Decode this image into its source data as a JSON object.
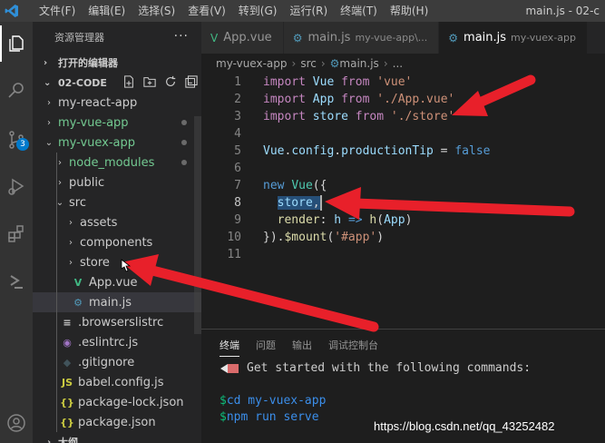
{
  "titlebar": {
    "menu": [
      "文件(F)",
      "编辑(E)",
      "选择(S)",
      "查看(V)",
      "转到(G)",
      "运行(R)",
      "终端(T)",
      "帮助(H)"
    ],
    "title": "main.js - 02-c"
  },
  "activitybar": {
    "icons": [
      "explorer-icon",
      "search-icon",
      "source-control-icon",
      "run-debug-icon",
      "extensions-icon",
      "remote-icon",
      "account-icon"
    ],
    "scm_badge": "3"
  },
  "sidebar": {
    "header": "资源管理器",
    "more": "···",
    "open_editors": "打开的编辑器",
    "workspace": "02-CODE",
    "tree": [
      {
        "label": "my-react-app",
        "chev": "›",
        "depth": 1,
        "color": "#cccccc",
        "dot": false
      },
      {
        "label": "my-vue-app",
        "chev": "›",
        "depth": 1,
        "color": "#73c991",
        "dot": true
      },
      {
        "label": "my-vuex-app",
        "chev": "⌄",
        "depth": 1,
        "color": "#73c991",
        "dot": true
      },
      {
        "label": "node_modules",
        "chev": "›",
        "depth": 2,
        "color": "#73c991",
        "dot": true
      },
      {
        "label": "public",
        "chev": "›",
        "depth": 2,
        "color": "#cccccc",
        "dot": false
      },
      {
        "label": "src",
        "chev": "⌄",
        "depth": 2,
        "color": "#cccccc",
        "dot": false
      },
      {
        "label": "assets",
        "chev": "›",
        "depth": 3,
        "color": "#cccccc",
        "dot": false
      },
      {
        "label": "components",
        "chev": "›",
        "depth": 3,
        "color": "#cccccc",
        "dot": false
      },
      {
        "label": "store",
        "chev": "›",
        "depth": 3,
        "color": "#cccccc",
        "dot": false
      },
      {
        "label": "App.vue",
        "chev": "",
        "depth": 3,
        "color": "#cccccc",
        "icon": "V",
        "iconColor": "#41b883",
        "dot": false
      },
      {
        "label": "main.js",
        "chev": "",
        "depth": 3,
        "color": "#cccccc",
        "icon": "⚙",
        "iconColor": "#519aba",
        "dot": false,
        "selected": true
      },
      {
        "label": ".browserslistrc",
        "chev": "",
        "depth": 2,
        "color": "#cccccc",
        "icon": "≡",
        "iconColor": "#cccccc",
        "dot": false
      },
      {
        "label": ".eslintrc.js",
        "chev": "",
        "depth": 2,
        "color": "#cccccc",
        "icon": "◉",
        "iconColor": "#a074c4",
        "dot": false
      },
      {
        "label": ".gitignore",
        "chev": "",
        "depth": 2,
        "color": "#cccccc",
        "icon": "◆",
        "iconColor": "#41535b",
        "dot": false
      },
      {
        "label": "babel.config.js",
        "chev": "",
        "depth": 2,
        "color": "#cccccc",
        "icon": "JS",
        "iconColor": "#cbcb41",
        "dot": false
      },
      {
        "label": "package-lock.json",
        "chev": "",
        "depth": 2,
        "color": "#cccccc",
        "icon": "{}",
        "iconColor": "#cbcb41",
        "dot": false
      },
      {
        "label": "package.json",
        "chev": "",
        "depth": 2,
        "color": "#cccccc",
        "icon": "{}",
        "iconColor": "#cbcb41",
        "dot": false
      },
      {
        "label": "大纲",
        "chev": "›",
        "depth": 0,
        "color": "#cccccc",
        "dot": false
      }
    ]
  },
  "tabs": [
    {
      "label": "App.vue",
      "desc": "",
      "icon": "V",
      "iconColor": "#41b883",
      "active": false
    },
    {
      "label": "main.js",
      "desc": "my-vue-app\\...",
      "icon": "⚙",
      "iconColor": "#519aba",
      "active": false
    },
    {
      "label": "main.js",
      "desc": "my-vuex-app",
      "icon": "⚙",
      "iconColor": "#519aba",
      "active": true
    }
  ],
  "breadcrumb": [
    "my-vuex-app",
    "src",
    "main.js",
    "..."
  ],
  "code": {
    "lines": [
      {
        "n": "1",
        "html": "<span class='kw2'>import</span> <span class='var'>Vue</span> <span class='kw2'>from</span> <span class='str'>'vue'</span>"
      },
      {
        "n": "2",
        "html": "<span class='kw2'>import</span> <span class='var'>App</span> <span class='kw2'>from</span> <span class='str'>'./App.vue'</span>"
      },
      {
        "n": "3",
        "html": "<span class='kw2'>import</span> <span class='var'>store</span> <span class='kw2'>from</span> <span class='str'>'./store'</span>"
      },
      {
        "n": "4",
        "html": ""
      },
      {
        "n": "5",
        "html": "<span class='var'>Vue</span>.<span class='var'>config</span>.<span class='var'>productionTip</span> = <span class='kw'>false</span>"
      },
      {
        "n": "6",
        "html": ""
      },
      {
        "n": "7",
        "html": "<span class='kw'>new</span> <span class='cls'>Vue</span>({"
      },
      {
        "n": "8",
        "html": "  <span class='hl'><span class='var'>store</span>,</span><span class='caret'></span>",
        "current": true
      },
      {
        "n": "9",
        "html": "  <span class='fn'>render</span>: <span class='var'>h</span> <span class='kw'>=&gt;</span> <span class='fn'>h</span>(<span class='var'>App</span>)"
      },
      {
        "n": "10",
        "html": "}).<span class='fn'>$mount</span>(<span class='str'>'#app'</span>)"
      },
      {
        "n": "11",
        "html": ""
      }
    ]
  },
  "panel": {
    "tabs": [
      "终端",
      "问题",
      "输出",
      "调试控制台"
    ],
    "active_tab": 0,
    "terminal": {
      "intro": "Get started with the following commands:",
      "cmd1": "cd my-vuex-app",
      "cmd2": "npm run serve",
      "prompt": "$"
    }
  },
  "watermark": "https://blog.csdn.net/qq_43252482",
  "colors": {
    "arrow": "#e8202a",
    "accent": "#007acc"
  }
}
